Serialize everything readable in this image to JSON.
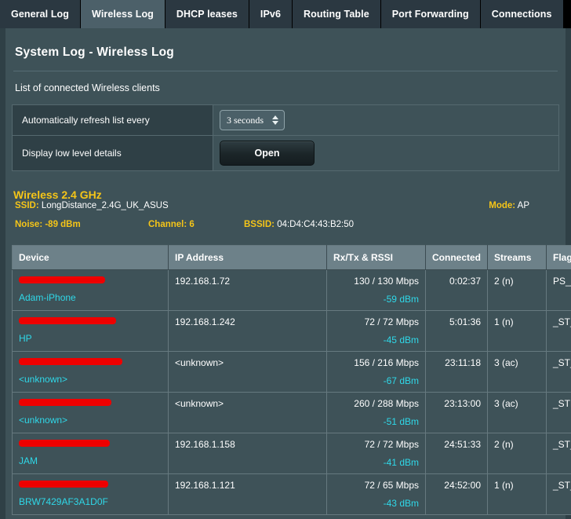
{
  "tabs": [
    {
      "label": "General Log",
      "active": false
    },
    {
      "label": "Wireless Log",
      "active": true
    },
    {
      "label": "DHCP leases",
      "active": false
    },
    {
      "label": "IPv6",
      "active": false
    },
    {
      "label": "Routing Table",
      "active": false
    },
    {
      "label": "Port Forwarding",
      "active": false
    },
    {
      "label": "Connections",
      "active": false
    }
  ],
  "page": {
    "title": "System Log - Wireless Log",
    "subtitle": "List of connected Wireless clients"
  },
  "settings": {
    "refresh_label": "Automatically refresh list every",
    "refresh_value": "3 seconds",
    "lowlevel_label": "Display low level details",
    "open_button": "Open"
  },
  "wireless": {
    "band_title": "Wireless 2.4 GHz",
    "ssid_label": "SSID:",
    "ssid_value": "LongDistance_2.4G_UK_ASUS",
    "mode_label": "Mode:",
    "mode_value": "AP",
    "noise": "Noise: -89 dBm",
    "channel": "Channel: 6",
    "bssid_label": "BSSID:",
    "bssid_value": "04:D4:C4:43:B2:50"
  },
  "table": {
    "headers": {
      "device": "Device",
      "ip": "IP Address",
      "rxtx": "Rx/Tx & RSSI",
      "connected": "Connected",
      "streams": "Streams",
      "flags": "Flags"
    },
    "rows": [
      {
        "mac": "XX:XX:XX:XX:XX:XX",
        "mac_redacted": true,
        "redact_width": 110,
        "hostname": "Adam-iPhone",
        "ip": "192.168.1.72",
        "rate": "130 / 130 Mbps",
        "rssi": "-59 dBm",
        "connected": "0:02:37",
        "streams": "2 (n)",
        "flags": "PS__AU_"
      },
      {
        "mac": "XX:XX:XX:XX:XX:XX",
        "mac_redacted": true,
        "redact_width": 124,
        "hostname": "HP",
        "ip": "192.168.1.242",
        "rate": "72 / 72 Mbps",
        "rssi": "-45 dBm",
        "connected": "5:01:36",
        "streams": "1 (n)",
        "flags": "_ST_AU_"
      },
      {
        "mac": "XX:XX:XX:XX:XX:XX",
        "mac_redacted": true,
        "redact_width": 132,
        "hostname": "<unknown>",
        "ip": "<unknown>",
        "rate": "156 / 216 Mbps",
        "rssi": "-67 dBm",
        "connected": "23:11:18",
        "streams": "3 (ac)",
        "flags": "_ST_AU_"
      },
      {
        "mac": "XX:XX:XX:XX:XX:XX",
        "mac_redacted": true,
        "redact_width": 118,
        "hostname": "<unknown>",
        "ip": "<unknown>",
        "rate": "260 / 288 Mbps",
        "rssi": "-51 dBm",
        "connected": "23:13:00",
        "streams": "3 (ac)",
        "flags": "_STMAU_"
      },
      {
        "mac": "XX:XX:XX:XX:XX:XX",
        "mac_redacted": true,
        "redact_width": 116,
        "hostname": "JAM",
        "ip": "192.168.1.158",
        "rate": "72 / 72 Mbps",
        "rssi": "-41 dBm",
        "connected": "24:51:33",
        "streams": "2 (n)",
        "flags": "_ST_AU_"
      },
      {
        "mac": "7429AF3A1D0F",
        "mac_redacted": true,
        "redact_width": 114,
        "hostname": "BRW7429AF3A1D0F",
        "ip": "192.168.1.121",
        "rate": "72 / 65 Mbps",
        "rssi": "-43 dBm",
        "connected": "24:52:00",
        "streams": "1 (n)",
        "flags": "_ST_AU_"
      }
    ]
  },
  "colors": {
    "accent_yellow": "#f5c518",
    "accent_cyan": "#2fd8e8",
    "redaction": "#ee0000",
    "page_bg": "#3e5258",
    "header_bg": "#6d8189"
  }
}
